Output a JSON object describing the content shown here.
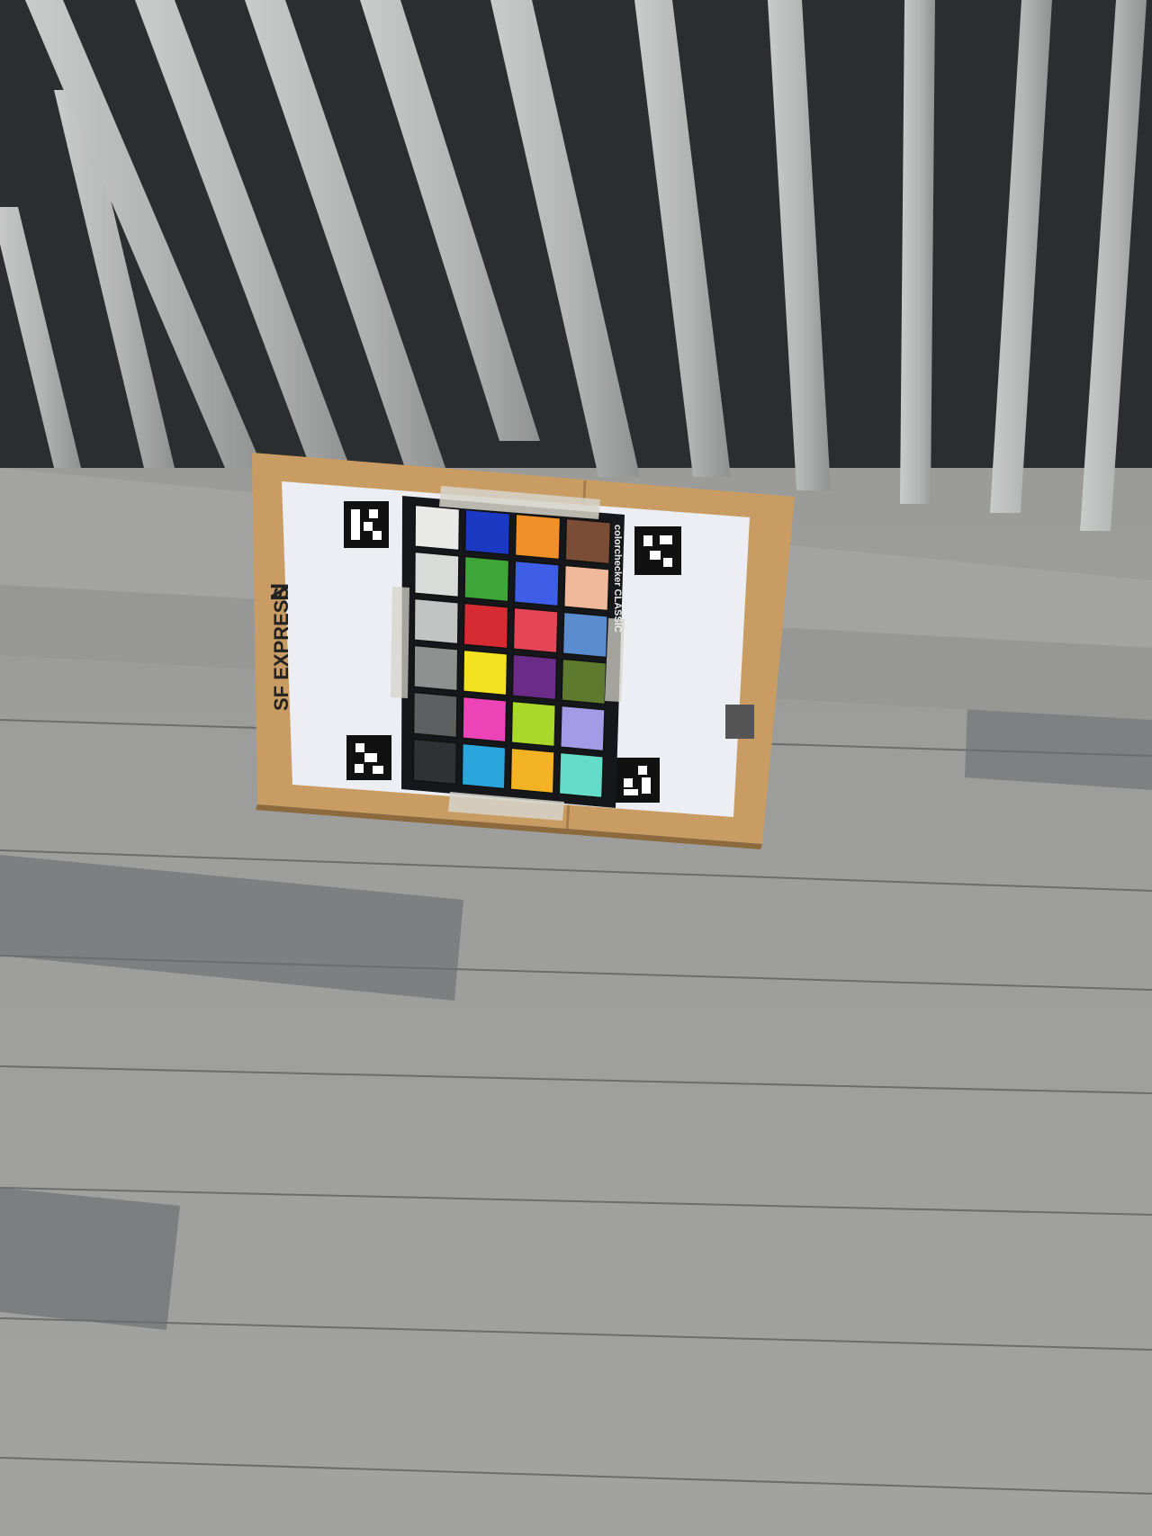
{
  "photo": {
    "subject": "color calibration chart on cardboard",
    "box_print": {
      "brand": "SF EXPRESS",
      "mark": "N"
    },
    "chart_print": "colorchecker CLASSIC",
    "colors": {
      "background_dark": "#2b2d2e",
      "slat": "#b7bab8",
      "slat_shadow": "#8b8e8d",
      "ledge": "#a9aaa7",
      "floor": "#9d9d9b",
      "floor_dark": "#7e7f80",
      "cardboard": "#c79a63",
      "paper": "#eceef3",
      "tape": "#d6d3c9",
      "chart_frame": "#15171a"
    },
    "patches": [
      [
        "#e9e9e6",
        "#1c39c4",
        "#f0902a",
        "#7b4c36"
      ],
      [
        "#d9dbd8",
        "#3ea638",
        "#3e5ee8",
        "#efb99a"
      ],
      [
        "#c2c4c3",
        "#d62b33",
        "#e44658",
        "#5b8ccf"
      ],
      [
        "#8f9191",
        "#f4e11f",
        "#6a2c86",
        "#5e7a2e"
      ],
      [
        "#5d5f60",
        "#ec44b6",
        "#a9d82b",
        "#a59ae6"
      ],
      [
        "#2f3134",
        "#2aa6dc",
        "#f4b324",
        "#64dcc9"
      ]
    ]
  }
}
